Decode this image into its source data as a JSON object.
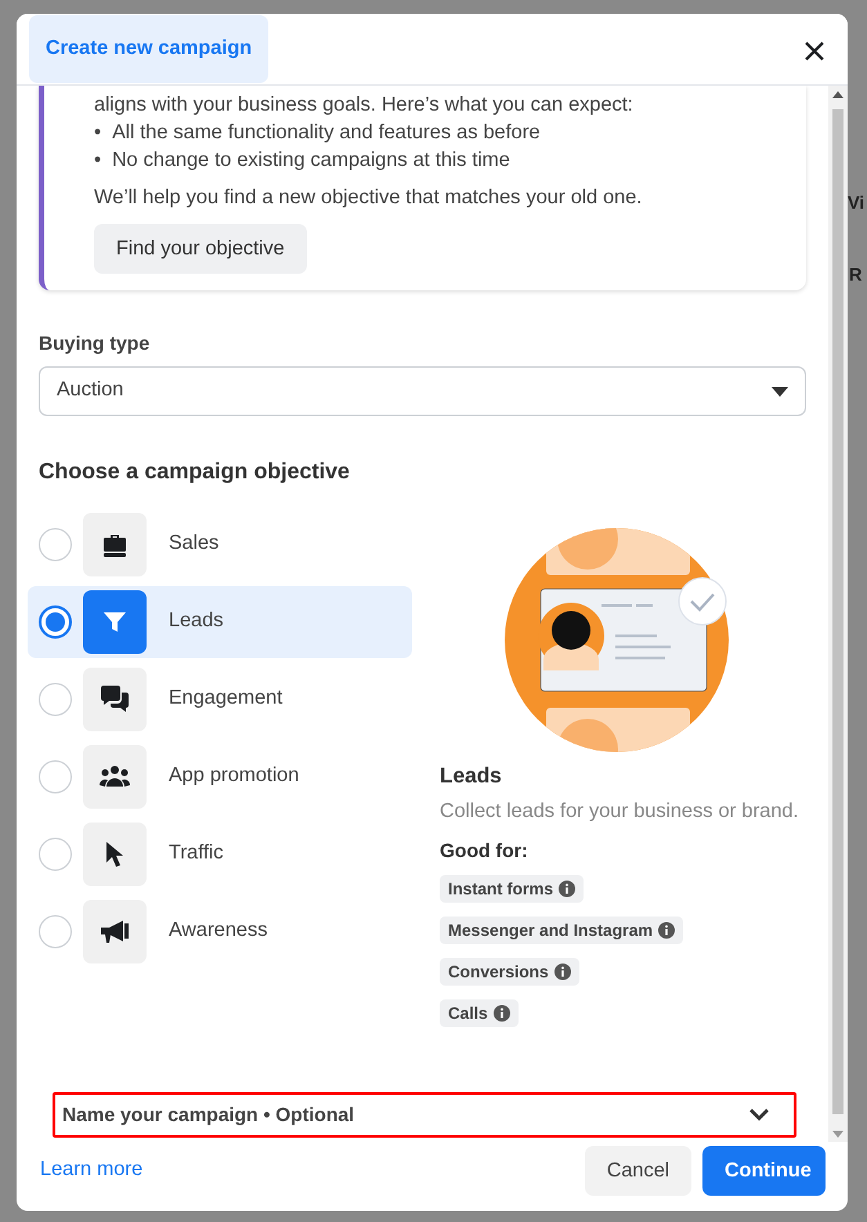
{
  "backdrop": {
    "fragments": [
      "Vi",
      "R"
    ]
  },
  "dialog": {
    "title": "Create new campaign"
  },
  "notice": {
    "lines": [
      "aligns with your business goals. Here’s what you can expect:"
    ],
    "bullet_marker": "•",
    "bullets": [
      "All the same functionality and features as before",
      "No change to existing campaigns at this time"
    ],
    "closing": "We’ll help you find a new objective that matches your old one.",
    "button": "Find your objective"
  },
  "buying_type": {
    "label": "Buying type",
    "value": "Auction"
  },
  "objectives_heading": "Choose a campaign objective",
  "objectives": [
    {
      "label": "Sales",
      "selected": false
    },
    {
      "label": "Leads",
      "selected": true
    },
    {
      "label": "Engagement",
      "selected": false
    },
    {
      "label": "App promotion",
      "selected": false
    },
    {
      "label": "Traffic",
      "selected": false
    },
    {
      "label": "Awareness",
      "selected": false
    }
  ],
  "detail": {
    "title": "Leads",
    "description": "Collect leads for your business or brand.",
    "good_for_label": "Good for:",
    "tags": [
      "Instant forms",
      "Messenger and Instagram",
      "Conversions",
      "Calls"
    ]
  },
  "name_section": {
    "label": "Name your campaign • Optional",
    "expanded": false,
    "highlighted": true
  },
  "footer": {
    "link": "Learn more",
    "cancel": "Cancel",
    "continue": "Continue"
  }
}
